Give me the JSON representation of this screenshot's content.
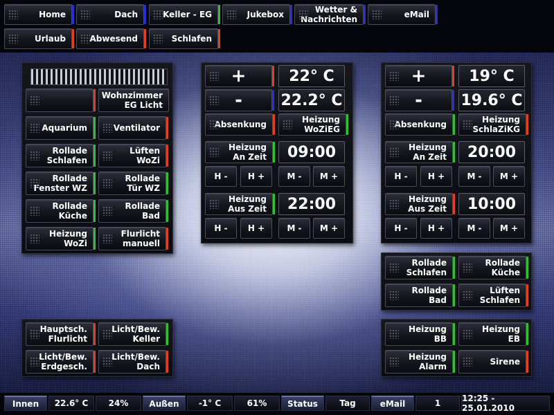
{
  "nav": {
    "home": "Home",
    "dach": "Dach",
    "keller": "Keller - EG",
    "jukebox": "Jukebox",
    "wetter": "Wetter &\nNachrichten",
    "email": "eMail",
    "urlaub": "Urlaub",
    "abwesend": "Abwesend",
    "schlafen": "Schlafen"
  },
  "left_panel": {
    "wohnzimmer": "Wohnzimmer\nEG Licht",
    "aquarium": "Aquarium",
    "ventilator": "Ventilator",
    "rollade_schlafen": "Rollade\nSchlafen",
    "lueften_wozi": "Lüften\nWoZi",
    "rollade_fenster": "Rollade\nFenster WZ",
    "rollade_tuer": "Rollade\nTür WZ",
    "rollade_kueche": "Rollade\nKüche",
    "rollade_bad": "Rollade\nBad",
    "heizung_wozi": "Heizung\nWoZi",
    "flurlicht": "Flurlicht\nmanuell"
  },
  "heat1": {
    "plus": "+",
    "minus": "-",
    "setpoint": "22° C",
    "actual": "22.2° C",
    "absenkung": "Absenkung",
    "heizung": "Heizung\nWoZiEG",
    "an_zeit_label": "Heizung\nAn Zeit",
    "an_zeit": "09:00",
    "aus_zeit_label": "Heizung\nAus Zeit",
    "aus_zeit": "22:00",
    "h_minus": "H -",
    "h_plus": "H +",
    "m_minus": "M -",
    "m_plus": "M +"
  },
  "heat2": {
    "plus": "+",
    "minus": "-",
    "setpoint": "19° C",
    "actual": "19.6° C",
    "absenkung": "Absenkung",
    "heizung": "Heizung\nSchlaZiKG",
    "an_zeit_label": "Heizung\nAn Zeit",
    "an_zeit": "20:00",
    "aus_zeit_label": "Heizung\nAus Zeit",
    "aus_zeit": "10:00",
    "h_minus": "H -",
    "h_plus": "H +",
    "m_minus": "M -",
    "m_plus": "M +"
  },
  "right_blinds": {
    "rollade_schlafen": "Rollade\nSchlafen",
    "rollade_kueche": "Rollade\nKüche",
    "rollade_bad": "Rollade\nBad",
    "lueften_schlafen": "Lüften\nSchlafen"
  },
  "bottom_left": {
    "hauptsch": "Hauptsch.\nFlurlicht",
    "licht_keller": "Licht/Bew.\nKeller",
    "licht_erdgesch": "Licht/Bew.\nErdgesch.",
    "licht_dach": "Licht/Bew.\nDach"
  },
  "bottom_right": {
    "heizung_bb": "Heizung\nBB",
    "heizung_eb": "Heizung\nEB",
    "heizung_alarm": "Heizung\nAlarm",
    "sirene": "Sirene"
  },
  "status": {
    "innen": "Innen",
    "innen_temp": "22.6° C",
    "innen_hum": "24%",
    "aussen": "Außen",
    "aussen_temp": "-1° C",
    "aussen_hum": "61%",
    "status": "Status",
    "tag": "Tag",
    "email": "eMail",
    "email_count": "1",
    "datetime": "12:25 - 25.01.2010"
  },
  "colors": {
    "red": "#e04020",
    "green": "#30c030",
    "blue": "#2a2cd8"
  }
}
